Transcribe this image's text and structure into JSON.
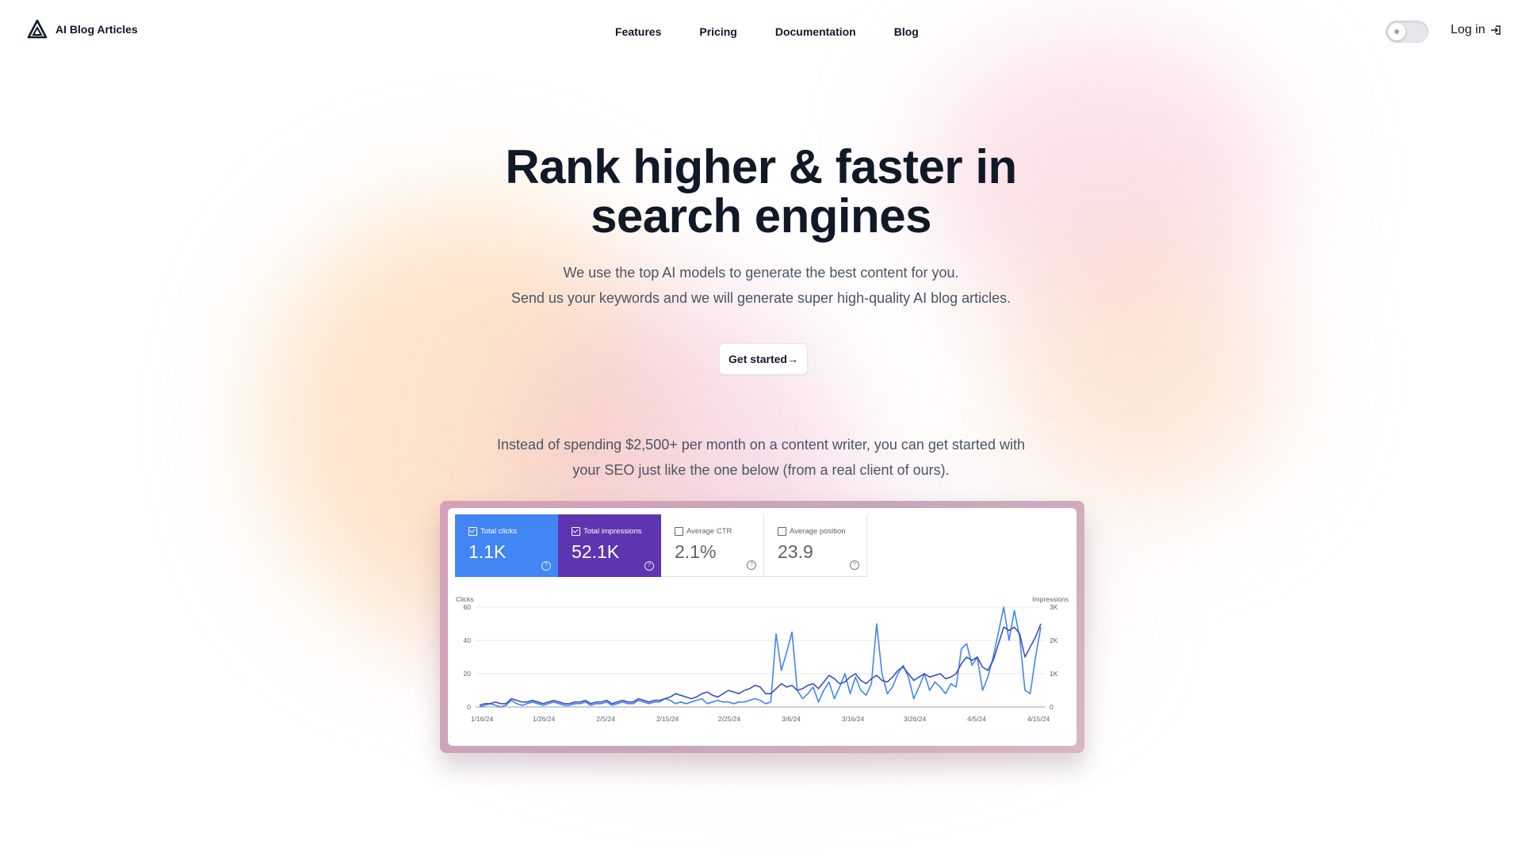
{
  "brand": {
    "name": "AI Blog Articles",
    "logo_icon": "triangle-logo-icon"
  },
  "nav": {
    "items": [
      "Features",
      "Pricing",
      "Documentation",
      "Blog"
    ]
  },
  "header": {
    "login_label": "Log in",
    "login_icon": "login-arrow-icon",
    "theme_toggle_icon": "sun-icon"
  },
  "hero": {
    "title_line1": "Rank higher & faster in",
    "title_line2": "search engines",
    "subtitle_line1": "We use the top AI models to generate the best content for you.",
    "subtitle_line2": "Send us your keywords and we will generate super high-quality AI blog articles.",
    "cta_label": "Get started",
    "cta_arrow": "→",
    "promo_line1": "Instead of spending $2,500+ per month on a content writer, you can get started with",
    "promo_line2": "your SEO just like the one below (from a real client of ours)."
  },
  "dashboard": {
    "metrics": [
      {
        "label": "Total clicks",
        "value": "1.1K",
        "checked": true
      },
      {
        "label": "Total impressions",
        "value": "52.1K",
        "checked": true
      },
      {
        "label": "Average CTR",
        "value": "2.1%",
        "checked": false
      },
      {
        "label": "Average position",
        "value": "23.9",
        "checked": false
      }
    ],
    "colors": {
      "clicks": "#4285f4",
      "impressions": "#5e35b1"
    }
  },
  "chart_data": {
    "type": "line",
    "ylabel_left": "Clicks",
    "ylabel_right": "Impressions",
    "yticks_left": [
      "60",
      "40",
      "20",
      "0"
    ],
    "yticks_right": [
      "3K",
      "2K",
      "1K",
      "0"
    ],
    "ylim_left": [
      0,
      60
    ],
    "ylim_right": [
      0,
      3000
    ],
    "xtick_labels": [
      "1/16/24",
      "1/26/24",
      "2/5/24",
      "2/15/24",
      "2/25/24",
      "3/6/24",
      "3/16/24",
      "3/26/24",
      "4/5/24",
      "4/15/24"
    ],
    "grid": true,
    "series": [
      {
        "name": "Clicks",
        "color": "#4285f4",
        "axis": "left",
        "values": [
          0,
          1,
          2,
          1,
          0,
          1,
          4,
          2,
          1,
          2,
          3,
          2,
          1,
          2,
          3,
          2,
          1,
          1,
          2,
          2,
          3,
          1,
          2,
          2,
          3,
          1,
          2,
          3,
          2,
          2,
          4,
          3,
          2,
          3,
          3,
          5,
          4,
          2,
          3,
          2,
          3,
          4,
          5,
          2,
          3,
          4,
          3,
          3,
          2,
          3,
          3,
          4,
          5,
          4,
          2,
          3,
          44,
          22,
          33,
          45,
          10,
          5,
          8,
          12,
          3,
          10,
          15,
          5,
          12,
          20,
          8,
          18,
          10,
          7,
          14,
          50,
          20,
          8,
          12,
          20,
          25,
          18,
          5,
          12,
          20,
          10,
          15,
          12,
          8,
          14,
          12,
          35,
          38,
          25,
          30,
          10,
          18,
          30,
          45,
          60,
          40,
          58,
          42,
          10,
          8,
          30,
          48
        ]
      },
      {
        "name": "Impressions",
        "color": "#3f51b5",
        "axis": "right",
        "values": [
          50,
          100,
          100,
          150,
          100,
          100,
          250,
          200,
          150,
          150,
          200,
          150,
          100,
          150,
          200,
          150,
          100,
          100,
          150,
          150,
          200,
          100,
          150,
          150,
          200,
          100,
          150,
          200,
          150,
          150,
          250,
          200,
          150,
          200,
          200,
          250,
          300,
          400,
          350,
          300,
          250,
          300,
          400,
          450,
          350,
          300,
          400,
          500,
          450,
          400,
          500,
          550,
          650,
          600,
          400,
          400,
          550,
          700,
          600,
          650,
          500,
          550,
          650,
          700,
          550,
          750,
          950,
          850,
          700,
          750,
          900,
          1000,
          800,
          700,
          850,
          950,
          800,
          750,
          900,
          1100,
          1200,
          1000,
          800,
          900,
          1000,
          900,
          950,
          1000,
          850,
          900,
          1000,
          1300,
          1500,
          1400,
          1500,
          1200,
          1100,
          1400,
          1900,
          2400,
          2300,
          2400,
          2200,
          1500,
          1800,
          2100,
          2500
        ]
      }
    ]
  }
}
